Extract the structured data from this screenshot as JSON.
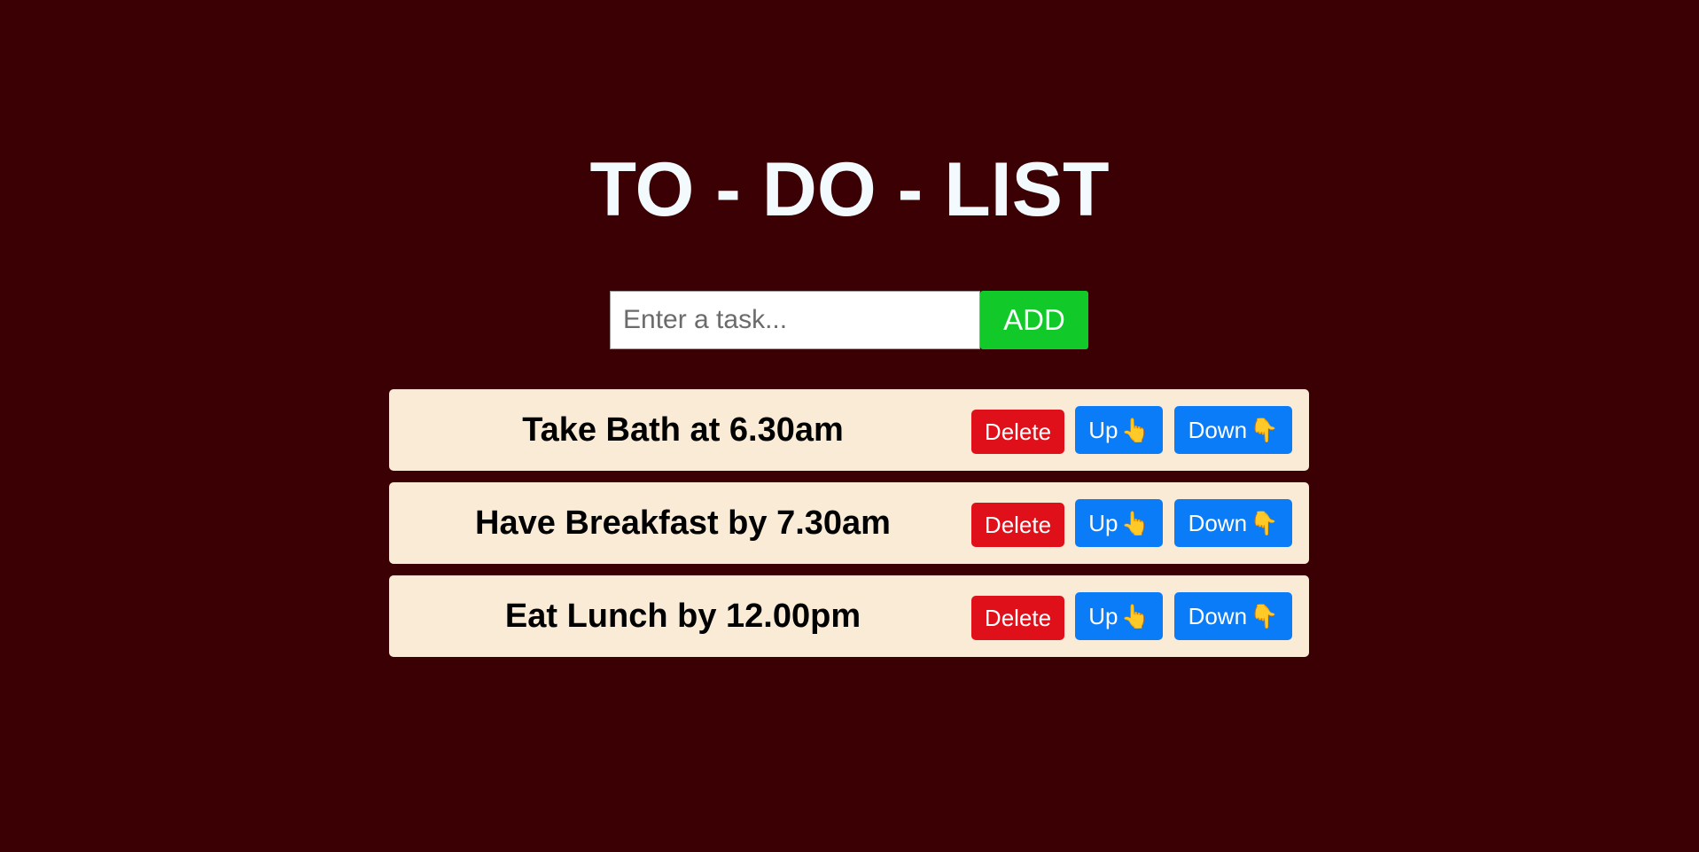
{
  "header": {
    "title": "TO - DO - LIST"
  },
  "add_form": {
    "placeholder": "Enter a task...",
    "value": "",
    "add_label": "ADD"
  },
  "colors": {
    "background": "#3a0003",
    "item_background": "#faebd7",
    "add_button": "#12c92a",
    "delete_button": "#e0101a",
    "move_button": "#0a7cf7"
  },
  "tasks": [
    {
      "text": "Take Bath at 6.30am",
      "delete_label": "Delete",
      "up_label": "Up",
      "up_icon": "👆",
      "down_label": "Down",
      "down_icon": "👇"
    },
    {
      "text": "Have Breakfast by 7.30am",
      "delete_label": "Delete",
      "up_label": "Up",
      "up_icon": "👆",
      "down_label": "Down",
      "down_icon": "👇"
    },
    {
      "text": "Eat Lunch by 12.00pm",
      "delete_label": "Delete",
      "up_label": "Up",
      "up_icon": "👆",
      "down_label": "Down",
      "down_icon": "👇"
    }
  ]
}
